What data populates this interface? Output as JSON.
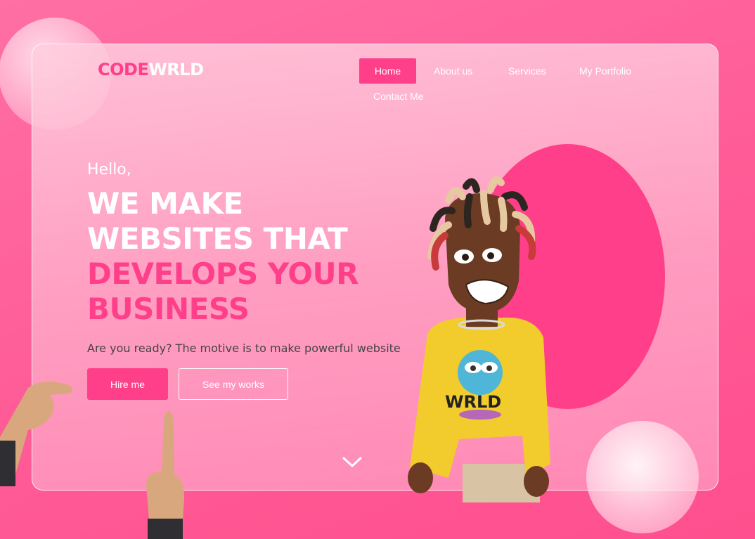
{
  "brand": {
    "logo_part1": "CODE",
    "logo_part2": "WRLD"
  },
  "nav": {
    "items": [
      "Home",
      "About us",
      "Services",
      "My Portfolio",
      "Contact Me"
    ],
    "active": "Home"
  },
  "hero": {
    "greeting": "Hello,",
    "headline_line1": "WE MAKE",
    "headline_line2": "WEBSITES THAT",
    "headline_line3": "DEVELOPS YOUR",
    "headline_line4": "BUSINESS",
    "subtitle": "Are you ready? The motive is to make powerful website",
    "primary_button": "Hire me",
    "secondary_button": "See my works"
  },
  "illustration": {
    "shirt_text": "WRLD"
  },
  "icons": {
    "scroll": "chevron-down-icon"
  },
  "colors": {
    "accent": "#ff3f8a",
    "background": "#ff5e98",
    "text_dark": "#444444"
  }
}
